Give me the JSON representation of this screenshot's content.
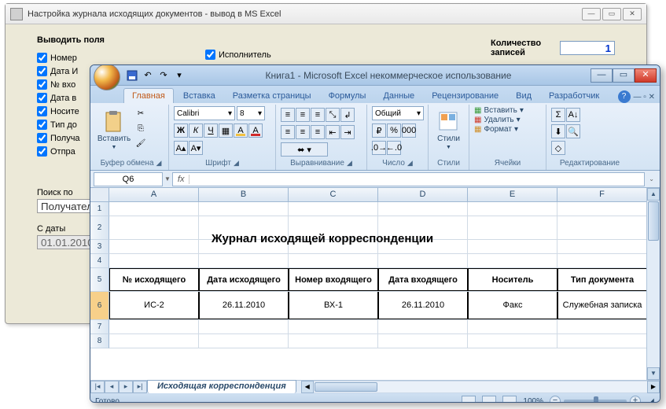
{
  "dialog": {
    "title": "Настройка журнала исходящих документов - вывод в MS Excel",
    "group_title": "Выводить поля",
    "center_check": "Исполнитель",
    "count_label": "Количество записей",
    "count_value": "1",
    "checks": [
      "Номер",
      "Дата И",
      "№ вхо",
      "Дата в",
      "Носите",
      "Тип до",
      "Получа",
      "Отпра"
    ],
    "search_label": "Поиск по",
    "search_value": "Получатель",
    "date_label": "С даты",
    "date_value": "01.01.2010"
  },
  "excel": {
    "title": "Книга1 - Microsoft Excel некоммерческое использование",
    "tabs": [
      "Главная",
      "Вставка",
      "Разметка страницы",
      "Формулы",
      "Данные",
      "Рецензирование",
      "Вид",
      "Разработчик"
    ],
    "ribbon": {
      "paste": "Вставить",
      "clipboard": "Буфер обмена",
      "font_name": "Calibri",
      "font_size": "8",
      "font": "Шрифт",
      "alignment": "Выравнивание",
      "number_format": "Общий",
      "number": "Число",
      "styles": "Стили",
      "styles_btn": "Стили",
      "cells": "Ячейки",
      "insert": "Вставить",
      "delete": "Удалить",
      "format": "Формат",
      "editing": "Редактирование"
    },
    "namebox": "Q6",
    "fx": "fx",
    "columns": [
      "A",
      "B",
      "C",
      "D",
      "E",
      "F"
    ],
    "rows": [
      "1",
      "2",
      "3",
      "4",
      "5",
      "6",
      "7",
      "8"
    ],
    "doc_title": "Журнал исходящей корреспонденции",
    "table_headers": [
      "№ исходящего",
      "Дата исходящего",
      "Номер входящего",
      "Дата входящего",
      "Носитель",
      "Тип документа"
    ],
    "table_row": [
      "ИС-2",
      "26.11.2010",
      "ВХ-1",
      "26.11.2010",
      "Факс",
      "Служебная записка"
    ],
    "sheet_tab": "Исходящая корреспонденция",
    "status": "Готово",
    "zoom": "100%"
  },
  "chart_data": {
    "type": "table",
    "title": "Журнал исходящей корреспонденции",
    "columns": [
      "№ исходящего",
      "Дата исходящего",
      "Номер входящего",
      "Дата входящего",
      "Носитель",
      "Тип документа"
    ],
    "rows": [
      [
        "ИС-2",
        "26.11.2010",
        "ВХ-1",
        "26.11.2010",
        "Факс",
        "Служебная записка"
      ]
    ]
  }
}
